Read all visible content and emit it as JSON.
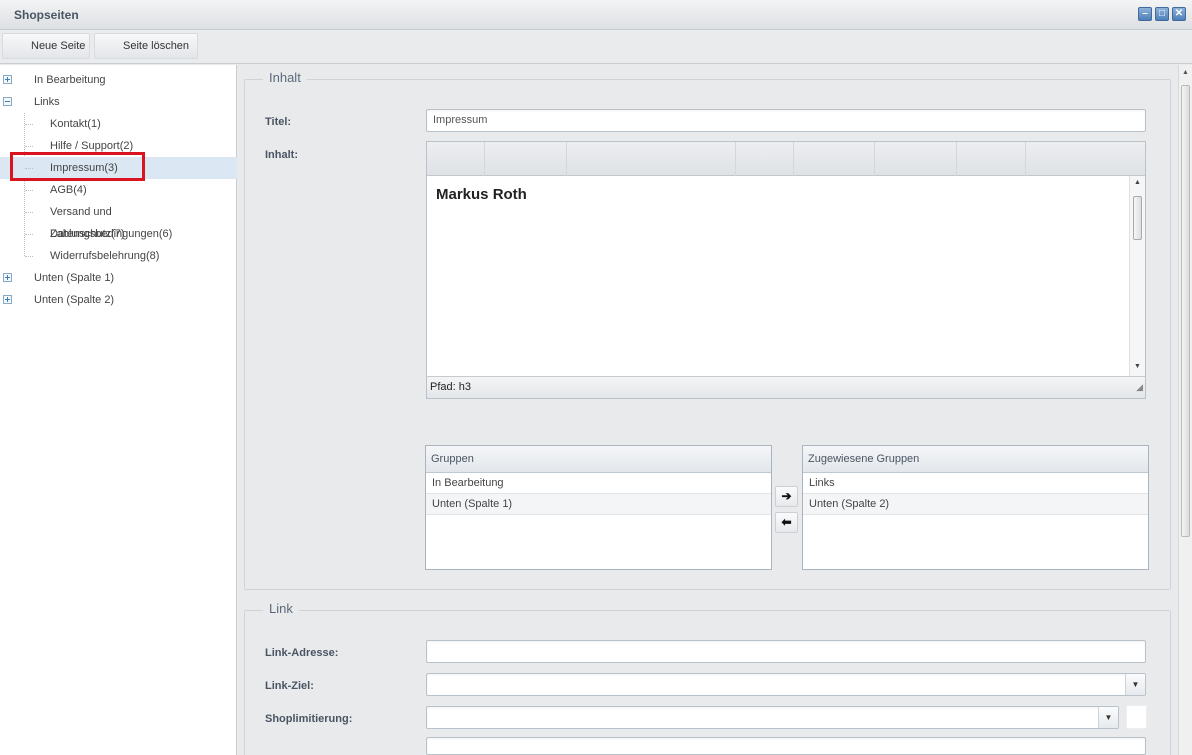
{
  "window": {
    "title": "Shopseiten"
  },
  "toolbar": {
    "new_page": "Neue Seite",
    "delete_page": "Seite löschen"
  },
  "tree": {
    "groups": [
      {
        "label": "In Bearbeitung",
        "expanded": false
      },
      {
        "label": "Links",
        "expanded": true
      },
      {
        "label": "Unten (Spalte 1)",
        "expanded": false
      },
      {
        "label": "Unten (Spalte 2)",
        "expanded": false
      }
    ],
    "children": [
      "Kontakt(1)",
      "Hilfe / Support(2)",
      "Impressum(3)",
      "AGB(4)",
      "Versand und Zahlungsbedingungen(6)",
      "Datenschutz(7)",
      "Widerrufsbelehrung(8)"
    ],
    "selected": "Impressum(3)"
  },
  "content": {
    "legend": "Inhalt",
    "title_label": "Titel:",
    "title_value": "Impressum",
    "body_label": "Inhalt:",
    "editor_heading": "Markus Roth",
    "editor_path": "Pfad: h3"
  },
  "groups": {
    "available_header": "Gruppen",
    "available": [
      "In Bearbeitung",
      "Unten (Spalte 1)"
    ],
    "assigned_header": "Zugewiesene Gruppen",
    "assigned": [
      "Links",
      "Unten (Spalte 2)"
    ],
    "move_right": "➔",
    "move_left": "⬅"
  },
  "link": {
    "legend": "Link",
    "address_label": "Link-Adresse:",
    "address_value": "",
    "target_label": "Link-Ziel:",
    "target_value": "",
    "shop_limit_label": "Shoplimitierung:",
    "shop_limit_value": ""
  },
  "colors": {
    "accent": "#4d7fb8",
    "selection": "#dbe8f3",
    "highlight_box": "#d9131f"
  }
}
